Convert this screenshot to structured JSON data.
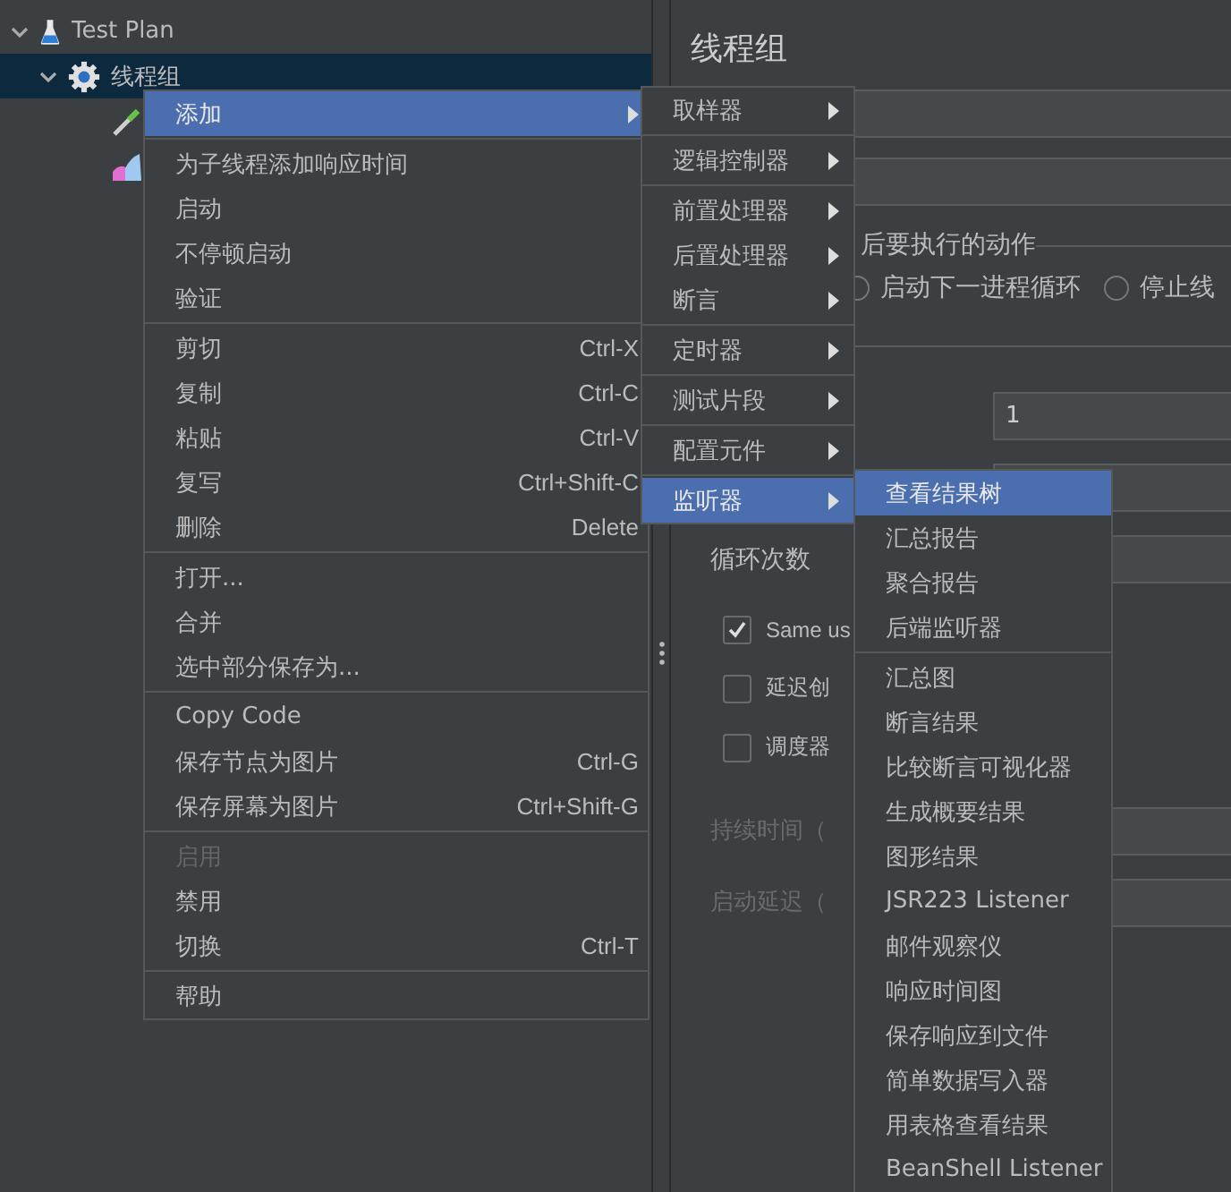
{
  "tree": [
    {
      "kind": "plan",
      "label": "Test Plan",
      "expanded": true,
      "selected": false,
      "children": [
        {
          "kind": "thread-group",
          "label": "线程组",
          "expanded": true,
          "selected": true,
          "children": [
            {
              "kind": "sampler"
            },
            {
              "kind": "listener"
            }
          ]
        }
      ]
    }
  ],
  "panel": {
    "title": "线程组",
    "error_action": {
      "label": "后要执行的动作",
      "options": [
        {
          "label": "启动下一进程循环",
          "selected": false
        },
        {
          "label": "停止线",
          "selected": false
        }
      ]
    },
    "threads_value": "1",
    "loop_label": "循环次数",
    "checkboxes": [
      {
        "label": "Same us",
        "checked": true
      },
      {
        "label": "延迟创",
        "checked": false
      },
      {
        "label": "调度器",
        "checked": false
      }
    ],
    "disabled_labels": [
      "持续时间（",
      "启动延迟（"
    ]
  },
  "context_menu": {
    "groups": [
      [
        {
          "label": "添加",
          "submenu": true,
          "selected": true,
          "disabled": false
        }
      ],
      [
        {
          "label": "为子线程添加响应时间",
          "submenu": false,
          "selected": false,
          "disabled": false
        },
        {
          "label": "启动",
          "submenu": false,
          "selected": false,
          "disabled": false
        },
        {
          "label": "不停顿启动",
          "submenu": false,
          "selected": false,
          "disabled": false
        },
        {
          "label": "验证",
          "submenu": false,
          "selected": false,
          "disabled": false
        }
      ],
      [
        {
          "label": "剪切",
          "shortcut": "Ctrl-X",
          "submenu": false,
          "selected": false,
          "disabled": false
        },
        {
          "label": "复制",
          "shortcut": "Ctrl-C",
          "submenu": false,
          "selected": false,
          "disabled": false
        },
        {
          "label": "粘贴",
          "shortcut": "Ctrl-V",
          "submenu": false,
          "selected": false,
          "disabled": false
        },
        {
          "label": "复写",
          "shortcut": "Ctrl+Shift-C",
          "submenu": false,
          "selected": false,
          "disabled": false
        },
        {
          "label": "删除",
          "shortcut": "Delete",
          "submenu": false,
          "selected": false,
          "disabled": false
        }
      ],
      [
        {
          "label": "打开...",
          "submenu": false,
          "selected": false,
          "disabled": false
        },
        {
          "label": "合并",
          "submenu": false,
          "selected": false,
          "disabled": false
        },
        {
          "label": "选中部分保存为...",
          "submenu": false,
          "selected": false,
          "disabled": false
        }
      ],
      [
        {
          "label": "Copy Code",
          "submenu": false,
          "selected": false,
          "disabled": false
        },
        {
          "label": "保存节点为图片",
          "shortcut": "Ctrl-G",
          "submenu": false,
          "selected": false,
          "disabled": false
        },
        {
          "label": "保存屏幕为图片",
          "shortcut": "Ctrl+Shift-G",
          "submenu": false,
          "selected": false,
          "disabled": false
        }
      ],
      [
        {
          "label": "启用",
          "submenu": false,
          "selected": false,
          "disabled": true
        },
        {
          "label": "禁用",
          "submenu": false,
          "selected": false,
          "disabled": false
        },
        {
          "label": "切换",
          "shortcut": "Ctrl-T",
          "submenu": false,
          "selected": false,
          "disabled": false
        }
      ],
      [
        {
          "label": "帮助",
          "submenu": false,
          "selected": false,
          "disabled": false
        }
      ]
    ]
  },
  "add_menu": {
    "groups": [
      [
        {
          "label": "取样器",
          "selected": false
        }
      ],
      [
        {
          "label": "逻辑控制器",
          "selected": false
        }
      ],
      [
        {
          "label": "前置处理器",
          "selected": false
        },
        {
          "label": "后置处理器",
          "selected": false
        },
        {
          "label": "断言",
          "selected": false
        }
      ],
      [
        {
          "label": "定时器",
          "selected": false
        }
      ],
      [
        {
          "label": "测试片段",
          "selected": false
        }
      ],
      [
        {
          "label": "配置元件",
          "selected": false
        }
      ],
      [
        {
          "label": "监听器",
          "selected": true
        }
      ]
    ]
  },
  "listener_menu": {
    "groups": [
      [
        {
          "label": "查看结果树",
          "selected": true
        },
        {
          "label": "汇总报告",
          "selected": false
        },
        {
          "label": "聚合报告",
          "selected": false
        },
        {
          "label": "后端监听器",
          "selected": false
        }
      ],
      [
        {
          "label": "汇总图",
          "selected": false
        },
        {
          "label": "断言结果",
          "selected": false
        },
        {
          "label": "比较断言可视化器",
          "selected": false
        },
        {
          "label": "生成概要结果",
          "selected": false
        },
        {
          "label": "图形结果",
          "selected": false
        },
        {
          "label": "JSR223 Listener",
          "selected": false
        },
        {
          "label": "邮件观察仪",
          "selected": false
        },
        {
          "label": "响应时间图",
          "selected": false
        },
        {
          "label": "保存响应到文件",
          "selected": false
        },
        {
          "label": "简单数据写入器",
          "selected": false
        },
        {
          "label": "用表格查看结果",
          "selected": false
        },
        {
          "label": "BeanShell Listener",
          "selected": false
        }
      ]
    ]
  }
}
